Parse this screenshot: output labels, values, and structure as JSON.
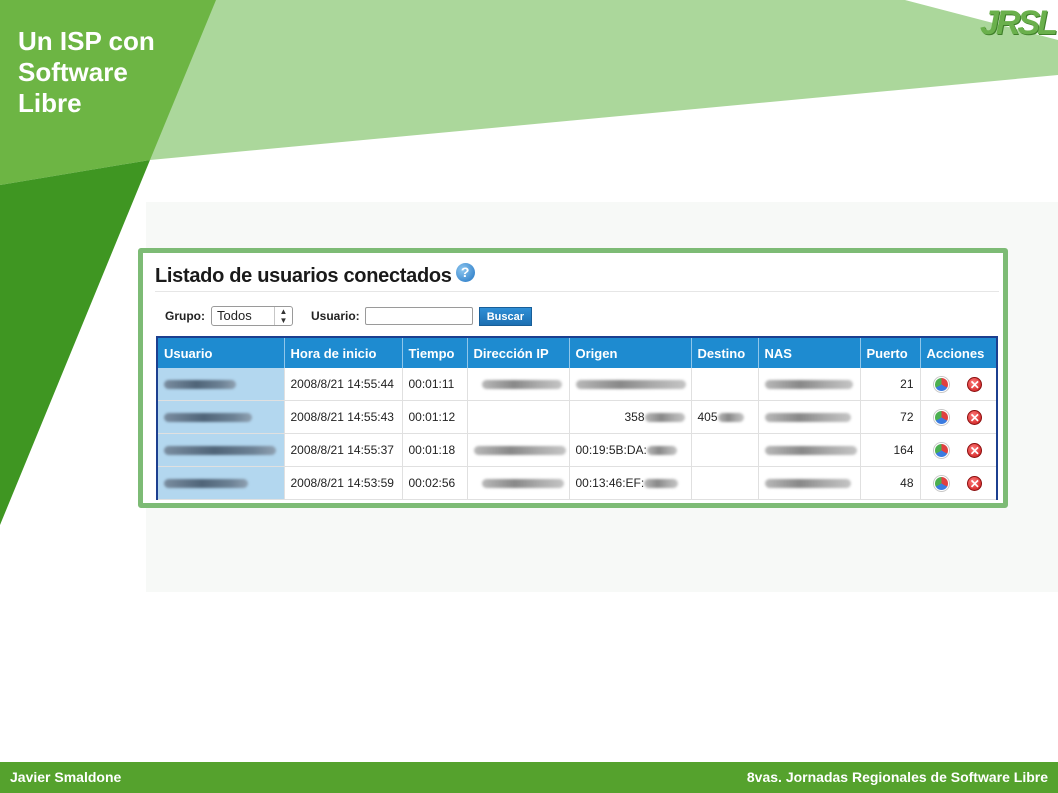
{
  "slide": {
    "title": "Un ISP con Software Libre",
    "logo_text": "JRSL",
    "footer_left": "Javier Smaldone",
    "footer_right": "8vas. Jornadas Regionales de Software Libre",
    "colors": {
      "dark_green": "#55a22d",
      "light_green": "#abd79b",
      "frame_green": "#7dbb75",
      "header_blue": "#1e8bd0"
    }
  },
  "screenshot": {
    "title": "Listado de usuarios conectados",
    "help_icon": "help-icon",
    "filters": {
      "grupo_label": "Grupo:",
      "grupo_value": "Todos",
      "usuario_label": "Usuario:",
      "usuario_value": "",
      "search_button": "Buscar"
    },
    "columns": [
      "Usuario",
      "Hora de inicio",
      "Tiempo",
      "Dirección IP",
      "Origen",
      "Destino",
      "NAS",
      "Puerto",
      "Acciones"
    ],
    "rows": [
      {
        "hora": "2008/8/21 14:55:44",
        "tiempo": "00:01:11",
        "origen": "",
        "destino": "",
        "puerto": "21"
      },
      {
        "hora": "2008/8/21 14:55:43",
        "tiempo": "00:01:12",
        "origen": "358",
        "destino": "405",
        "puerto": "72"
      },
      {
        "hora": "2008/8/21 14:55:37",
        "tiempo": "00:01:18",
        "origen": "00:19:5B:DA:",
        "destino": "",
        "puerto": "164"
      },
      {
        "hora": "2008/8/21 14:53:59",
        "tiempo": "00:02:56",
        "origen": "00:13:46:EF:",
        "destino": "",
        "puerto": "48"
      }
    ]
  }
}
